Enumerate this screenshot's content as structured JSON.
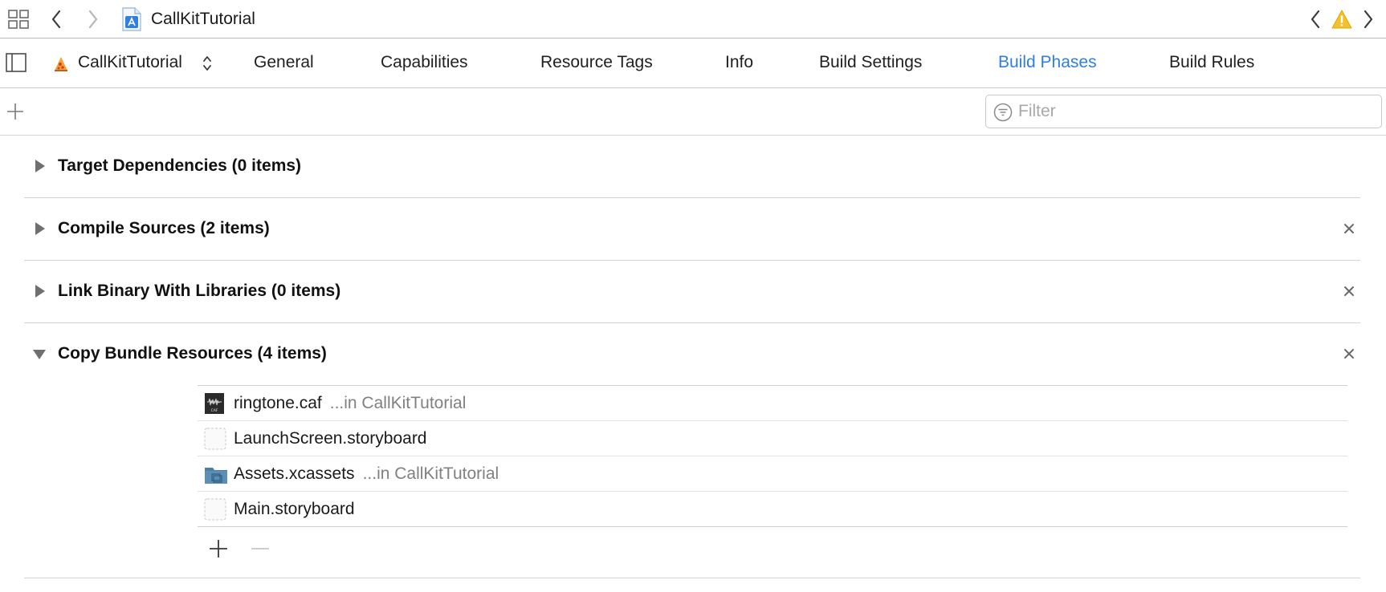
{
  "window": {
    "project_name": "CallKitTutorial"
  },
  "nav": {
    "icons": [
      "related-items-icon",
      "back-arrow-icon",
      "forward-arrow-icon",
      "project-file-icon",
      "issue-back-icon",
      "warning-icon",
      "issue-forward-icon"
    ]
  },
  "tabbar": {
    "target_label": "CallKitTutorial",
    "tabs": [
      {
        "label": "General"
      },
      {
        "label": "Capabilities"
      },
      {
        "label": "Resource Tags"
      },
      {
        "label": "Info"
      },
      {
        "label": "Build Settings"
      },
      {
        "label": "Build Phases",
        "active": true
      },
      {
        "label": "Build Rules"
      }
    ]
  },
  "filter": {
    "placeholder": "Filter",
    "value": ""
  },
  "phases": [
    {
      "title": "Target Dependencies (0 items)",
      "expanded": false,
      "removable": false
    },
    {
      "title": "Compile Sources (2 items)",
      "expanded": false,
      "removable": true
    },
    {
      "title": "Link Binary With Libraries (0 items)",
      "expanded": false,
      "removable": true
    },
    {
      "title": "Copy Bundle Resources (4 items)",
      "expanded": true,
      "removable": true
    }
  ],
  "resources": [
    {
      "name": "ringtone.caf",
      "location": "...in CallKitTutorial",
      "icon": "audio-file-icon"
    },
    {
      "name": "LaunchScreen.storyboard",
      "location": "",
      "icon": "storyboard-file-icon"
    },
    {
      "name": "Assets.xcassets",
      "location": "...in CallKitTutorial",
      "icon": "asset-catalog-icon"
    },
    {
      "name": "Main.storyboard",
      "location": "",
      "icon": "storyboard-file-icon"
    }
  ],
  "colors": {
    "accent": "#2f7ee0",
    "warning": "#f2c12e",
    "folder": "#4a7fa6"
  }
}
